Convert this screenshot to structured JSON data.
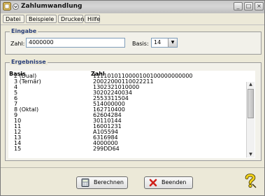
{
  "window": {
    "title": "Zahlumwandlung"
  },
  "menu": [
    "Datei",
    "Beispiele",
    "Drucken",
    "Hilfe"
  ],
  "input_group": {
    "title": "Eingabe",
    "number_label": "Zahl:",
    "number_value": "4000000",
    "base_label": "Basis:",
    "base_value": "14"
  },
  "results": {
    "title": "Ergebnisse",
    "col_base": "Basis",
    "col_number": "Zahl",
    "rows": [
      {
        "base": "2  (Dual)",
        "value": "1111010110000100100000000000"
      },
      {
        "base": "3  (Ternär)",
        "value": "20022000110022211"
      },
      {
        "base": "4",
        "value": "1302321010000"
      },
      {
        "base": "5",
        "value": "30202240034"
      },
      {
        "base": "6",
        "value": "2553311504"
      },
      {
        "base": "7",
        "value": "514000000"
      },
      {
        "base": "8  (Oktal)",
        "value": "162710400"
      },
      {
        "base": "9",
        "value": "62604284"
      },
      {
        "base": "10",
        "value": "30110144"
      },
      {
        "base": "11",
        "value": "16001231"
      },
      {
        "base": "12",
        "value": "A105594"
      },
      {
        "base": "13",
        "value": "6316984"
      },
      {
        "base": "14",
        "value": "4000000"
      },
      {
        "base": "15",
        "value": "299DD64"
      }
    ]
  },
  "buttons": {
    "calculate": "Berechnen",
    "exit": "Beenden"
  }
}
